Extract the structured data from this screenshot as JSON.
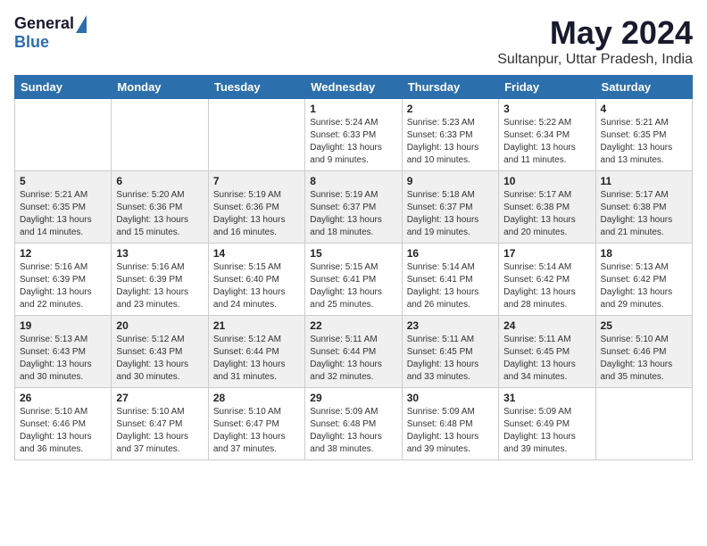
{
  "header": {
    "logo_general": "General",
    "logo_blue": "Blue",
    "month": "May 2024",
    "location": "Sultanpur, Uttar Pradesh, India"
  },
  "weekdays": [
    "Sunday",
    "Monday",
    "Tuesday",
    "Wednesday",
    "Thursday",
    "Friday",
    "Saturday"
  ],
  "weeks": [
    [
      {
        "day": "",
        "info": ""
      },
      {
        "day": "",
        "info": ""
      },
      {
        "day": "",
        "info": ""
      },
      {
        "day": "1",
        "info": "Sunrise: 5:24 AM\nSunset: 6:33 PM\nDaylight: 13 hours\nand 9 minutes."
      },
      {
        "day": "2",
        "info": "Sunrise: 5:23 AM\nSunset: 6:33 PM\nDaylight: 13 hours\nand 10 minutes."
      },
      {
        "day": "3",
        "info": "Sunrise: 5:22 AM\nSunset: 6:34 PM\nDaylight: 13 hours\nand 11 minutes."
      },
      {
        "day": "4",
        "info": "Sunrise: 5:21 AM\nSunset: 6:35 PM\nDaylight: 13 hours\nand 13 minutes."
      }
    ],
    [
      {
        "day": "5",
        "info": "Sunrise: 5:21 AM\nSunset: 6:35 PM\nDaylight: 13 hours\nand 14 minutes."
      },
      {
        "day": "6",
        "info": "Sunrise: 5:20 AM\nSunset: 6:36 PM\nDaylight: 13 hours\nand 15 minutes."
      },
      {
        "day": "7",
        "info": "Sunrise: 5:19 AM\nSunset: 6:36 PM\nDaylight: 13 hours\nand 16 minutes."
      },
      {
        "day": "8",
        "info": "Sunrise: 5:19 AM\nSunset: 6:37 PM\nDaylight: 13 hours\nand 18 minutes."
      },
      {
        "day": "9",
        "info": "Sunrise: 5:18 AM\nSunset: 6:37 PM\nDaylight: 13 hours\nand 19 minutes."
      },
      {
        "day": "10",
        "info": "Sunrise: 5:17 AM\nSunset: 6:38 PM\nDaylight: 13 hours\nand 20 minutes."
      },
      {
        "day": "11",
        "info": "Sunrise: 5:17 AM\nSunset: 6:38 PM\nDaylight: 13 hours\nand 21 minutes."
      }
    ],
    [
      {
        "day": "12",
        "info": "Sunrise: 5:16 AM\nSunset: 6:39 PM\nDaylight: 13 hours\nand 22 minutes."
      },
      {
        "day": "13",
        "info": "Sunrise: 5:16 AM\nSunset: 6:39 PM\nDaylight: 13 hours\nand 23 minutes."
      },
      {
        "day": "14",
        "info": "Sunrise: 5:15 AM\nSunset: 6:40 PM\nDaylight: 13 hours\nand 24 minutes."
      },
      {
        "day": "15",
        "info": "Sunrise: 5:15 AM\nSunset: 6:41 PM\nDaylight: 13 hours\nand 25 minutes."
      },
      {
        "day": "16",
        "info": "Sunrise: 5:14 AM\nSunset: 6:41 PM\nDaylight: 13 hours\nand 26 minutes."
      },
      {
        "day": "17",
        "info": "Sunrise: 5:14 AM\nSunset: 6:42 PM\nDaylight: 13 hours\nand 28 minutes."
      },
      {
        "day": "18",
        "info": "Sunrise: 5:13 AM\nSunset: 6:42 PM\nDaylight: 13 hours\nand 29 minutes."
      }
    ],
    [
      {
        "day": "19",
        "info": "Sunrise: 5:13 AM\nSunset: 6:43 PM\nDaylight: 13 hours\nand 30 minutes."
      },
      {
        "day": "20",
        "info": "Sunrise: 5:12 AM\nSunset: 6:43 PM\nDaylight: 13 hours\nand 30 minutes."
      },
      {
        "day": "21",
        "info": "Sunrise: 5:12 AM\nSunset: 6:44 PM\nDaylight: 13 hours\nand 31 minutes."
      },
      {
        "day": "22",
        "info": "Sunrise: 5:11 AM\nSunset: 6:44 PM\nDaylight: 13 hours\nand 32 minutes."
      },
      {
        "day": "23",
        "info": "Sunrise: 5:11 AM\nSunset: 6:45 PM\nDaylight: 13 hours\nand 33 minutes."
      },
      {
        "day": "24",
        "info": "Sunrise: 5:11 AM\nSunset: 6:45 PM\nDaylight: 13 hours\nand 34 minutes."
      },
      {
        "day": "25",
        "info": "Sunrise: 5:10 AM\nSunset: 6:46 PM\nDaylight: 13 hours\nand 35 minutes."
      }
    ],
    [
      {
        "day": "26",
        "info": "Sunrise: 5:10 AM\nSunset: 6:46 PM\nDaylight: 13 hours\nand 36 minutes."
      },
      {
        "day": "27",
        "info": "Sunrise: 5:10 AM\nSunset: 6:47 PM\nDaylight: 13 hours\nand 37 minutes."
      },
      {
        "day": "28",
        "info": "Sunrise: 5:10 AM\nSunset: 6:47 PM\nDaylight: 13 hours\nand 37 minutes."
      },
      {
        "day": "29",
        "info": "Sunrise: 5:09 AM\nSunset: 6:48 PM\nDaylight: 13 hours\nand 38 minutes."
      },
      {
        "day": "30",
        "info": "Sunrise: 5:09 AM\nSunset: 6:48 PM\nDaylight: 13 hours\nand 39 minutes."
      },
      {
        "day": "31",
        "info": "Sunrise: 5:09 AM\nSunset: 6:49 PM\nDaylight: 13 hours\nand 39 minutes."
      },
      {
        "day": "",
        "info": ""
      }
    ]
  ]
}
